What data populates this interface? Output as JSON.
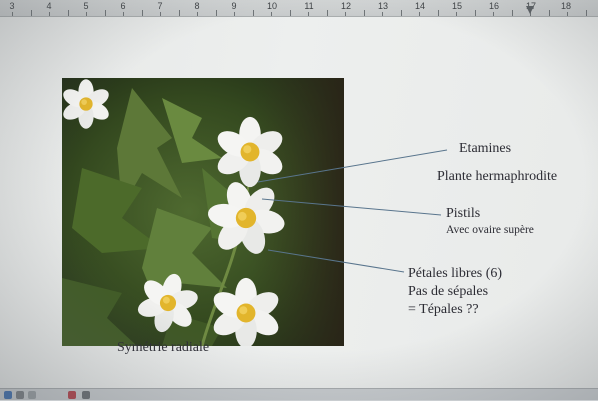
{
  "ruler": {
    "numbers": [
      "3",
      "4",
      "5",
      "6",
      "7",
      "8",
      "9",
      "10",
      "11",
      "12",
      "13",
      "14",
      "15",
      "16",
      "17",
      "18"
    ]
  },
  "photo": {
    "subject": "white wood anemone flowers with yellow stamens on green foliage",
    "colors": {
      "foliage": "#5d7838",
      "foliage_dark": "#25341a",
      "petal": "#f4f4f2",
      "stamen": "#e2b52c"
    }
  },
  "labels": {
    "etamines": "Etamines",
    "plante": "Plante hermaphrodite",
    "pistils": "Pistils",
    "ovaire": "Avec ovaire supère",
    "petales": "Pétales libres (6)",
    "sepales": "Pas de sépales",
    "tepales": "= Tépales ??",
    "symetrie": "Symétrie radiale"
  },
  "colors": {
    "leader_line": "#59758d",
    "text": "#2c2c34",
    "page": "#eceeed"
  }
}
